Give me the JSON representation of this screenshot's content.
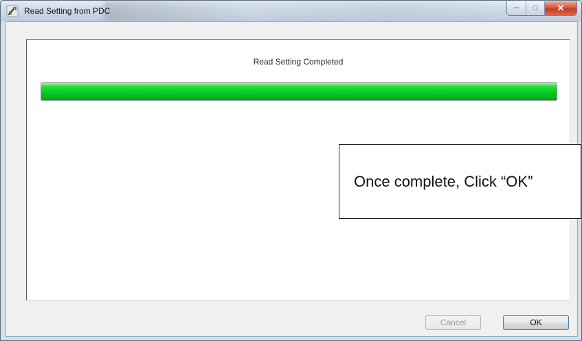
{
  "window": {
    "title": "Read Setting from PDC",
    "controls": {
      "minimize": "─",
      "maximize": "□",
      "close": "✕"
    }
  },
  "dialog": {
    "status_text": "Read Setting Completed",
    "progress": 1.0,
    "progress_color": "#07c923"
  },
  "callout": {
    "text": "Once complete, Click “OK”"
  },
  "buttons": {
    "cancel_label": "Cancel",
    "ok_label": "OK"
  }
}
